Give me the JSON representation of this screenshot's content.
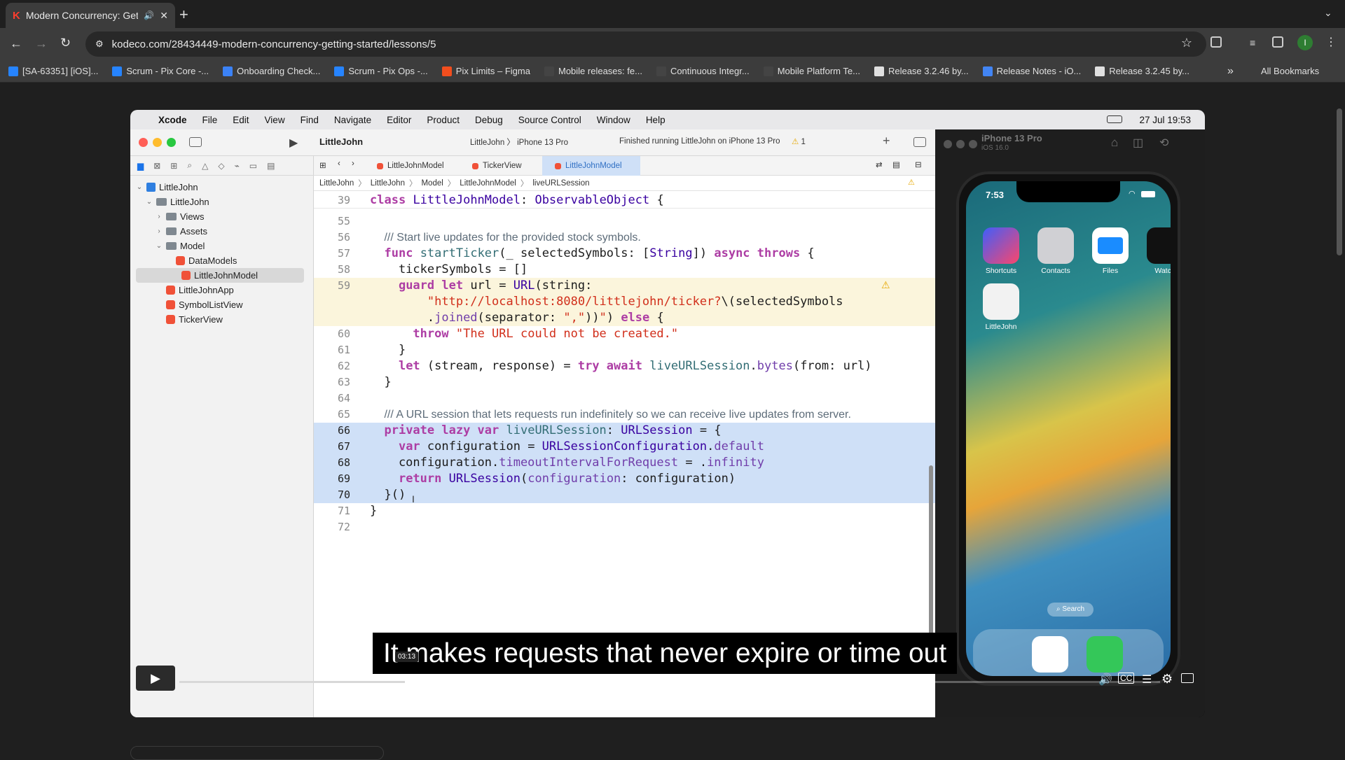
{
  "browser": {
    "tab_title": "Modern Concurrency: Get",
    "url": "kodeco.com/28434449-modern-concurrency-getting-started/lessons/5",
    "bookmarks": [
      {
        "label": "[SA-63351] [iOS]...",
        "color": "#2684ff"
      },
      {
        "label": "Scrum - Pix Core -...",
        "color": "#2684ff"
      },
      {
        "label": "Onboarding Check...",
        "color": "#3b82f6"
      },
      {
        "label": "Scrum - Pix Ops -...",
        "color": "#2684ff"
      },
      {
        "label": "Pix Limits – Figma",
        "color": "#f24e1e"
      },
      {
        "label": "Mobile releases: fe...",
        "color": "#444444"
      },
      {
        "label": "Continuous Integr...",
        "color": "#444444"
      },
      {
        "label": "Mobile Platform Te...",
        "color": "#444444"
      },
      {
        "label": "Release 3.2.46 by...",
        "color": "#e0e0e0"
      },
      {
        "label": "Release Notes - iO...",
        "color": "#4285f4"
      },
      {
        "label": "Release 3.2.45 by...",
        "color": "#e0e0e0"
      }
    ],
    "all_bookmarks": "All Bookmarks",
    "profile_initial": "I"
  },
  "mac": {
    "menus": [
      "Xcode",
      "File",
      "Edit",
      "View",
      "Find",
      "Navigate",
      "Editor",
      "Product",
      "Debug",
      "Source Control",
      "Window",
      "Help"
    ],
    "clock": "27 Jul  19:53"
  },
  "xcode": {
    "project": "LittleJohn",
    "scheme": "LittleJohn",
    "device": "iPhone 13 Pro",
    "status": "Finished running LittleJohn on iPhone 13 Pro",
    "warning_count": "1",
    "tabs": [
      "LittleJohnModel",
      "TickerView",
      "LittleJohnModel"
    ],
    "breadcrumb": [
      "LittleJohn",
      "LittleJohn",
      "Model",
      "LittleJohnModel",
      "liveURLSession"
    ],
    "tree": [
      {
        "label": "LittleJohn",
        "depth": 0,
        "kind": "project",
        "open": true
      },
      {
        "label": "LittleJohn",
        "depth": 1,
        "kind": "folder",
        "open": true
      },
      {
        "label": "Views",
        "depth": 2,
        "kind": "folder",
        "open": false
      },
      {
        "label": "Assets",
        "depth": 2,
        "kind": "folder",
        "open": false
      },
      {
        "label": "Model",
        "depth": 2,
        "kind": "folder",
        "open": true
      },
      {
        "label": "DataModels",
        "depth": 3,
        "kind": "swift"
      },
      {
        "label": "LittleJohnModel",
        "depth": 3,
        "kind": "swift",
        "selected": true
      },
      {
        "label": "LittleJohnApp",
        "depth": 2,
        "kind": "swift"
      },
      {
        "label": "SymbolListView",
        "depth": 2,
        "kind": "swift"
      },
      {
        "label": "TickerView",
        "depth": 2,
        "kind": "swift"
      }
    ]
  },
  "code": [
    {
      "ln": "39",
      "html": "<span class=\"kw\">class</span> <span class=\"ty\">LittleJohnModel</span>: <span class=\"ty\">ObservableObject</span> {",
      "sticky": true
    },
    {
      "ln": "55",
      "html": ""
    },
    {
      "ln": "56",
      "html": "  <span class=\"cm\">/// Start live updates for the provided stock symbols.</span>"
    },
    {
      "ln": "57",
      "html": "  <span class=\"kw\">func</span> <span class=\"fn\">startTicker</span>(_ selectedSymbols: [<span class=\"ty\">String</span>]) <span class=\"kw\">async throws</span> {"
    },
    {
      "ln": "58",
      "html": "    tickerSymbols = []"
    },
    {
      "ln": "59",
      "html": "    <span class=\"kw\">guard let</span> url = <span class=\"ty\">URL</span>(string:",
      "warn": true
    },
    {
      "ln": "",
      "html": "        <span class=\"str\">\"http://localhost:8080/littlejohn/ticker?</span>\\(selectedSymbols",
      "warn": true
    },
    {
      "ln": "",
      "html": "        .<span class=\"prop\">joined</span>(separator: <span class=\"str\">\",\"</span>))<span class=\"str\">\"</span>) <span class=\"kw\">else</span> {",
      "warn": true
    },
    {
      "ln": "60",
      "html": "      <span class=\"kw\">throw</span> <span class=\"str\">\"The URL could not be created.\"</span>"
    },
    {
      "ln": "61",
      "html": "    }"
    },
    {
      "ln": "62",
      "html": "    <span class=\"kw\">let</span> (stream, response) = <span class=\"kw\">try await</span> <span class=\"fn\">liveURLSession</span>.<span class=\"prop\">bytes</span>(from: url)"
    },
    {
      "ln": "63",
      "html": "  }"
    },
    {
      "ln": "64",
      "html": ""
    },
    {
      "ln": "65",
      "html": "  <span class=\"cm\">/// A URL session that lets requests run indefinitely so we can receive live updates from server.</span>"
    },
    {
      "ln": "66",
      "html": "  <span class=\"kw\">private lazy var</span> <span class=\"fn\">liveURLSession</span>: <span class=\"ty\">URLSession</span> = {",
      "sel": true
    },
    {
      "ln": "67",
      "html": "    <span class=\"kw\">var</span> configuration = <span class=\"ty\">URLSessionConfiguration</span>.<span class=\"prop\">default</span>",
      "sel": true
    },
    {
      "ln": "68",
      "html": "    configuration.<span class=\"prop\">timeoutIntervalForRequest</span> = .<span class=\"prop\">infinity</span>",
      "sel": true
    },
    {
      "ln": "69",
      "html": "    <span class=\"kw\">return</span> <span class=\"ty\">URLSession</span>(<span class=\"prop\">configuration</span>: configuration)",
      "sel": true
    },
    {
      "ln": "70",
      "html": "  }()",
      "sel": true
    },
    {
      "ln": "71",
      "html": "}"
    },
    {
      "ln": "72",
      "html": ""
    }
  ],
  "simulator": {
    "title": "iPhone 13 Pro",
    "subtitle": "iOS 16.0",
    "time": "7:53",
    "apps": [
      {
        "label": "Shortcuts",
        "color": "#c83a9a"
      },
      {
        "label": "Contacts",
        "color": "#c9c9ce"
      },
      {
        "label": "Files",
        "color": "#1a8cff"
      },
      {
        "label": "Watch",
        "color": "#111111"
      },
      {
        "label": "LittleJohn",
        "color": "#f0f0f0"
      }
    ],
    "search": "Search"
  },
  "video": {
    "caption": "It makes requests that never expire or time out",
    "timestamp": "03:13",
    "progress": 0.23
  }
}
